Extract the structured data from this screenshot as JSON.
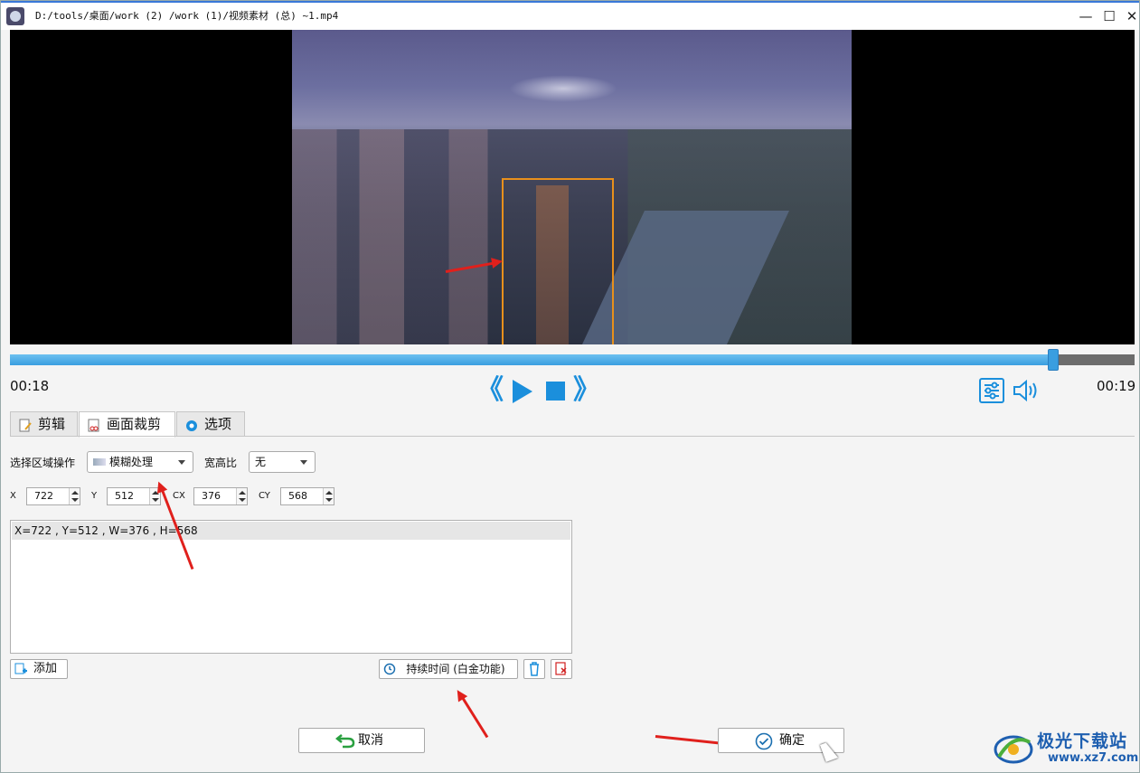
{
  "window": {
    "title": "D:/tools/桌面/work (2) /work (1)/视频素材 (总) ~1.mp4",
    "min_glyph": "—",
    "max_glyph": "☐",
    "close_glyph": "✕"
  },
  "player": {
    "progress_fraction": 0.928,
    "time_current": "00:18",
    "time_total": "00:19",
    "rewind_glyph": "《",
    "forward_glyph": "》"
  },
  "tabs": [
    {
      "label": "剪辑",
      "active": false
    },
    {
      "label": "画面裁剪",
      "active": true
    },
    {
      "label": "选项",
      "active": false
    }
  ],
  "crop": {
    "region_op_label": "选择区域操作",
    "region_op_value": "模糊处理",
    "aspect_label": "宽高比",
    "aspect_value": "无",
    "x_label": "X",
    "x_value": "722",
    "y_label": "Y",
    "y_value": "512",
    "cx_label": "CX",
    "cx_value": "376",
    "cy_label": "CY",
    "cy_value": "568",
    "list_items": [
      "X=722 , Y=512 , W=376 , H=568"
    ]
  },
  "buttons": {
    "add": "添加",
    "duration": "持续时间 (白金功能)",
    "cancel": "取消",
    "ok": "确定"
  },
  "watermark": {
    "name": "极光下载站",
    "url": "www.xz7.com"
  },
  "colors": {
    "accent": "#1b8fdc",
    "crop_box": "#e8901c",
    "annotation": "#e0201c"
  }
}
